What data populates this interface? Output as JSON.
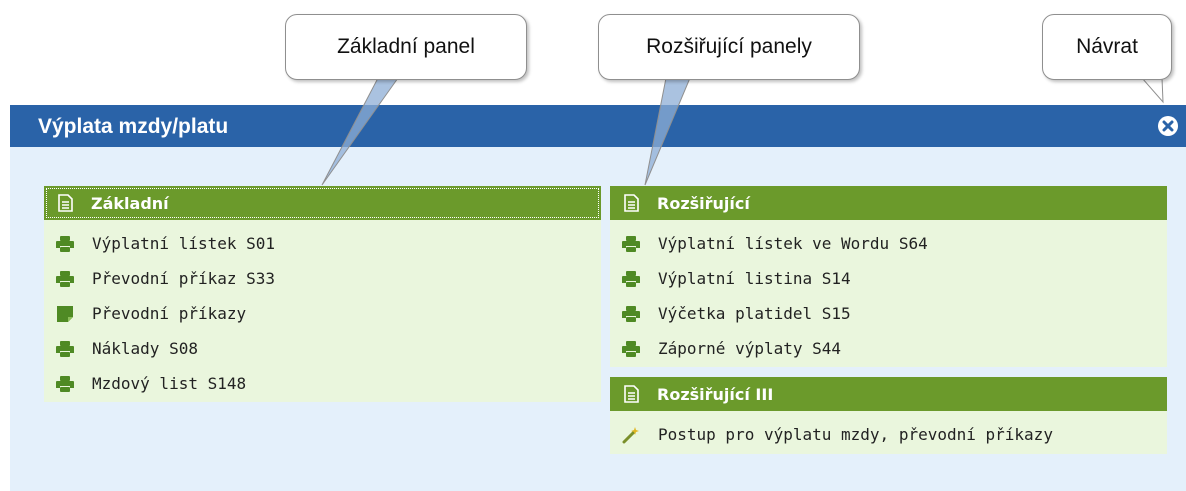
{
  "callouts": {
    "basic": "Základní panel",
    "extended": "Rozšiřující panely",
    "back": "Návrat"
  },
  "window": {
    "title": "Výplata mzdy/platu",
    "close_icon": "close-circle-icon"
  },
  "panels": [
    {
      "header": "Základní",
      "header_icon": "document-icon",
      "items": [
        {
          "label": "Výplatní lístek S01",
          "icon": "printer-icon"
        },
        {
          "label": "Převodní příkaz S33",
          "icon": "printer-icon"
        },
        {
          "label": "Převodní příkazy",
          "icon": "note-icon"
        },
        {
          "label": "Náklady S08",
          "icon": "printer-icon"
        },
        {
          "label": "Mzdový list S148",
          "icon": "printer-icon"
        }
      ]
    },
    {
      "header": "Rozšiřující",
      "header_icon": "document-icon",
      "items": [
        {
          "label": "Výplatní lístek ve Wordu S64",
          "icon": "printer-icon"
        },
        {
          "label": "Výplatní listina S14",
          "icon": "printer-icon"
        },
        {
          "label": "Výčetka platidel S15",
          "icon": "printer-icon"
        },
        {
          "label": "Záporné výplaty S44",
          "icon": "printer-icon"
        }
      ]
    },
    {
      "header": "Rozšiřující III",
      "header_icon": "document-icon",
      "items": [
        {
          "label": "Postup pro výplatu mzdy, převodní příkazy",
          "icon": "magic-wand-icon"
        }
      ]
    }
  ],
  "colors": {
    "titlebar": "#2a63a8",
    "window_bg": "#e4f0fb",
    "panel_header": "#6b9a2b",
    "panel_bg": "#eaf6dd",
    "icon_green": "#4f8a24"
  }
}
